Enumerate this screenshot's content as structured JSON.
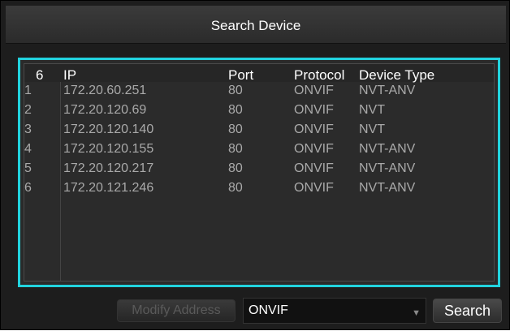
{
  "window": {
    "title": "Search Device"
  },
  "table": {
    "count": "6",
    "columns": [
      "IP",
      "Port",
      "Protocol",
      "Device Type"
    ],
    "rows": [
      {
        "num": "1",
        "ip": "172.20.60.251",
        "port": "80",
        "protocol": "ONVIF",
        "type": "NVT-ANV"
      },
      {
        "num": "2",
        "ip": "172.20.120.69",
        "port": "80",
        "protocol": "ONVIF",
        "type": "NVT"
      },
      {
        "num": "3",
        "ip": "172.20.120.140",
        "port": "80",
        "protocol": "ONVIF",
        "type": "NVT"
      },
      {
        "num": "4",
        "ip": "172.20.120.155",
        "port": "80",
        "protocol": "ONVIF",
        "type": "NVT-ANV"
      },
      {
        "num": "5",
        "ip": "172.20.120.217",
        "port": "80",
        "protocol": "ONVIF",
        "type": "NVT-ANV"
      },
      {
        "num": "6",
        "ip": "172.20.121.246",
        "port": "80",
        "protocol": "ONVIF",
        "type": "NVT-ANV"
      }
    ]
  },
  "footer": {
    "modify_label": "Modify Address",
    "protocol_select": "ONVIF",
    "search_label": "Search"
  },
  "colors": {
    "selection_border": "#22d3de",
    "dialog_bg": "#1d1d1d",
    "row_text": "#a9a9a9"
  }
}
